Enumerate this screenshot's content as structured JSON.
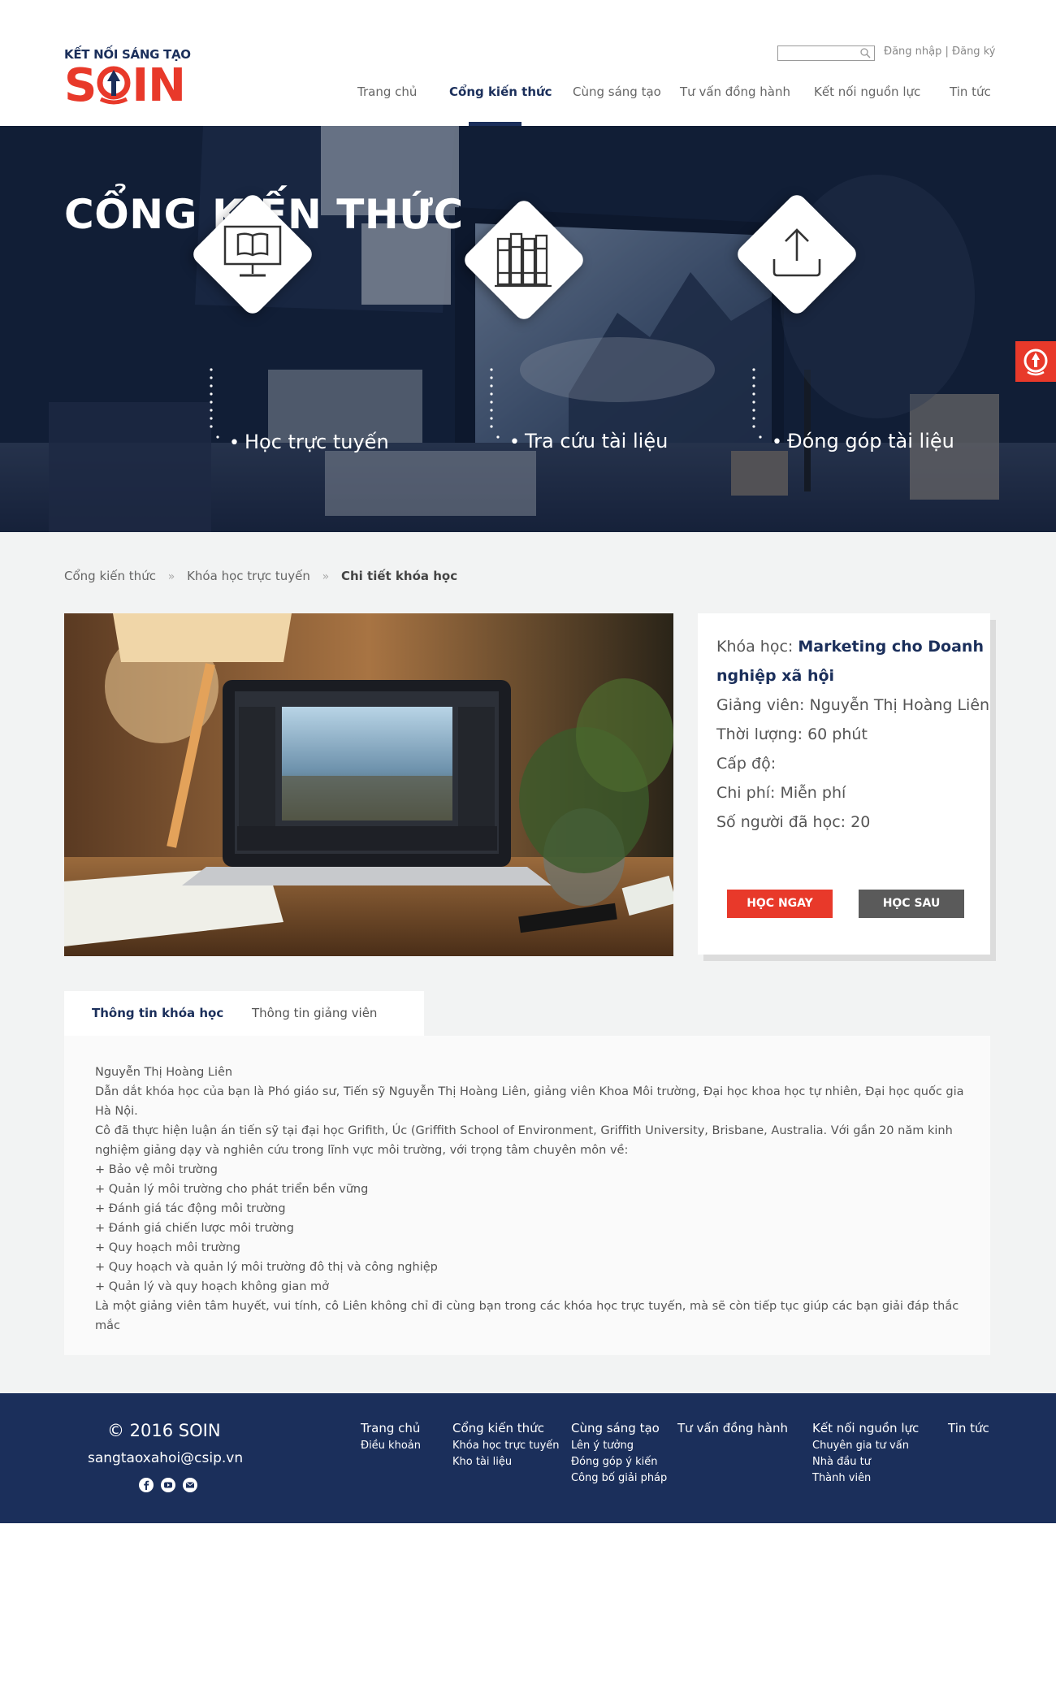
{
  "header": {
    "logo_tagline": "KẾT NỐI SÁNG TẠO",
    "logo_word_left": "S",
    "logo_word_right": "IN",
    "search_placeholder": "",
    "login": "Đăng nhập",
    "auth_separator": " | ",
    "register": "Đăng ký",
    "nav": [
      {
        "label": "Trang chủ"
      },
      {
        "label": "Cổng kiến thức",
        "active": true
      },
      {
        "label": "Cùng sáng tạo"
      },
      {
        "label": "Tư vấn đồng hành"
      },
      {
        "label": "Kết nối nguồn lực"
      },
      {
        "label": "Tin tức"
      }
    ]
  },
  "hero": {
    "title": "CỔNG KIẾN THỨC",
    "links": [
      {
        "label": "Học trực tuyến",
        "icon": "monitor-book-icon"
      },
      {
        "label": "Tra cứu tài liệu",
        "icon": "bookshelf-icon"
      },
      {
        "label": "Đóng góp tài liệu",
        "icon": "upload-icon"
      }
    ]
  },
  "breadcrumb": {
    "items": [
      "Cổng kiến thức",
      "Khóa học trực tuyến"
    ],
    "current": "Chi tiết khóa học",
    "separator": "»"
  },
  "course": {
    "course_label": "Khóa học: ",
    "course_name_line1": "Marketing cho Doanh",
    "course_name_line2": "nghiệp xã hội",
    "instructor": "Giảng viên: Nguyễn Thị Hoàng Liên",
    "duration": "Thời lượng: 60 phút",
    "level": "Cấp độ:",
    "cost": "Chi phí: Miễn phí",
    "learners": "Số người đã học: 20",
    "btn_now": "HỌC NGAY",
    "btn_later": "HỌC SAU"
  },
  "tabs": [
    {
      "label": "Thông tin khóa học",
      "active": true
    },
    {
      "label": "Thông tin giảng viên"
    }
  ],
  "description": [
    "Nguyễn Thị Hoàng Liên",
    "Dẫn dắt khóa học của bạn là Phó giáo sư, Tiến sỹ Nguyễn Thị Hoàng Liên, giảng viên Khoa Môi trường, Đại học khoa học tự nhiên, Đại học quốc gia Hà Nội.",
    "Cô đã thực hiện luận án tiến sỹ tại đại học Grifith, Úc (Griffith School of Environment, Griffith University, Brisbane, Australia. Với gần 20 năm kinh nghiệm giảng dạy và nghiên cứu trong lĩnh vực môi trường, với trọng tâm chuyên môn về:",
    "+ Bảo vệ môi trường",
    "+ Quản lý môi trường cho phát triển bền vững",
    "+ Đánh giá tác động môi trường",
    "+ Đánh giá chiến lược môi trường",
    "+ Quy hoạch môi trường",
    "+ Quy hoạch và quản lý môi trường đô thị và công nghiệp",
    "+ Quản lý và quy hoạch không gian mở",
    "Là một giảng viên tâm huyết, vui tính, cô Liên không chỉ đi cùng bạn trong các khóa học trực tuyến, mà sẽ còn tiếp tục giúp các bạn giải đáp thắc mắc"
  ],
  "footer": {
    "copyright": "© 2016 SOIN",
    "email": "sangtaoxahoi@csip.vn",
    "social": [
      "facebook-icon",
      "youtube-icon",
      "mail-icon"
    ],
    "columns": [
      {
        "head": "Trang chủ",
        "subs": [
          "Điều khoản"
        ]
      },
      {
        "head": "Cổng kiến thức",
        "subs": [
          "Khóa học trực tuyến",
          "Kho tài liệu"
        ]
      },
      {
        "head": "Cùng sáng tạo",
        "subs": [
          "Lên ý tưởng",
          "Đóng góp ý kiến",
          "Công bố giải pháp"
        ]
      },
      {
        "head": "Tư vấn đồng hành",
        "subs": []
      },
      {
        "head": "Kết nối nguồn lực",
        "subs": [
          "Chuyên gia tư vấn",
          "Nhà đầu tư",
          "Thành viên"
        ]
      },
      {
        "head": "Tin tức",
        "subs": []
      }
    ]
  },
  "colors": {
    "brand_red": "#e8392a",
    "brand_navy": "#1b2f5b",
    "button_gray": "#5a5a5a"
  }
}
